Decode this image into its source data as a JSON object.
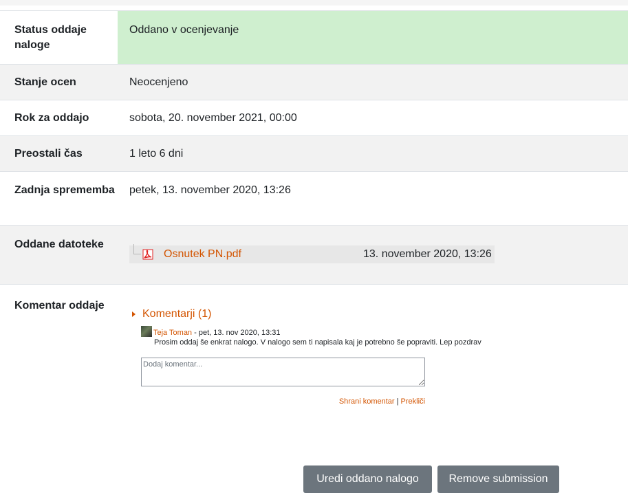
{
  "rows": [
    {
      "label": "Status oddaje naloge",
      "value": "Oddano v ocenjevanje"
    },
    {
      "label": "Stanje ocen",
      "value": "Neocenjeno"
    },
    {
      "label": "Rok za oddajo",
      "value": "sobota, 20. november 2021, 00:00"
    },
    {
      "label": "Preostali čas",
      "value": "1 leto 6 dni"
    },
    {
      "label": "Zadnja sprememba",
      "value": "petek, 13. november 2020, 13:26"
    },
    {
      "label": "Oddane datoteke"
    },
    {
      "label": "Komentar oddaje"
    }
  ],
  "file": {
    "name": "Osnutek PN.pdf",
    "date": "13. november 2020, 13:26",
    "icon": "pdf-icon"
  },
  "comments": {
    "toggle_label": "Komentarji (1)",
    "items": [
      {
        "author": "Teja Toman",
        "date": "- pet, 13. nov 2020, 13:31",
        "text": "Prosim oddaj še enkrat nalogo. V nalogo sem ti napisala kaj je potrebno še popraviti. Lep pozdrav"
      }
    ],
    "placeholder": "Dodaj komentar...",
    "save_label": "Shrani komentar",
    "separator": "|",
    "cancel_label": "Prekliči"
  },
  "buttons": {
    "edit_label": "Uredi oddano nalogo",
    "remove_label": "Remove submission"
  },
  "colors": {
    "link": "#d35400",
    "submitted_bg": "#cfefcf",
    "button_bg": "#6c757d"
  }
}
